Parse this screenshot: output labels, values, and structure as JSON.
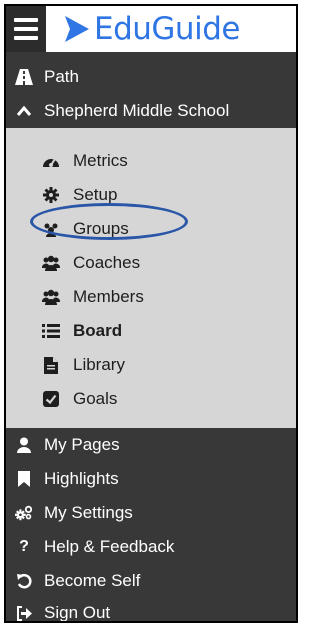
{
  "header": {
    "brand": "EduGuide",
    "brand_color": "#2f75e3",
    "menu_icon": "hamburger-menu-icon"
  },
  "top_items": [
    {
      "label": "Path",
      "icon": "road-icon"
    },
    {
      "label": "Shepherd Middle School",
      "icon": "chevron-up-icon"
    }
  ],
  "submenu": [
    {
      "label": "Metrics",
      "icon": "dashboard-icon"
    },
    {
      "label": "Setup",
      "icon": "gear-icon"
    },
    {
      "label": "Groups",
      "icon": "groups-icon",
      "highlighted": true
    },
    {
      "label": "Coaches",
      "icon": "users-icon"
    },
    {
      "label": "Members",
      "icon": "users-icon"
    },
    {
      "label": "Board",
      "icon": "list-icon",
      "bold": true
    },
    {
      "label": "Library",
      "icon": "file-icon"
    },
    {
      "label": "Goals",
      "icon": "checkbox-icon"
    }
  ],
  "bottom_items": [
    {
      "label": "My Pages",
      "icon": "user-icon"
    },
    {
      "label": "Highlights",
      "icon": "bookmark-icon"
    },
    {
      "label": "My Settings",
      "icon": "cogs-icon"
    },
    {
      "label": "Help & Feedback",
      "icon": "question-icon"
    },
    {
      "label": "Become Self",
      "icon": "undo-icon"
    },
    {
      "label": "Sign Out",
      "icon": "sign-out-icon"
    }
  ],
  "colors": {
    "sidebar_bg": "#383838",
    "submenu_bg": "#d6d6d6",
    "highlight_ring": "#2a56a8"
  }
}
